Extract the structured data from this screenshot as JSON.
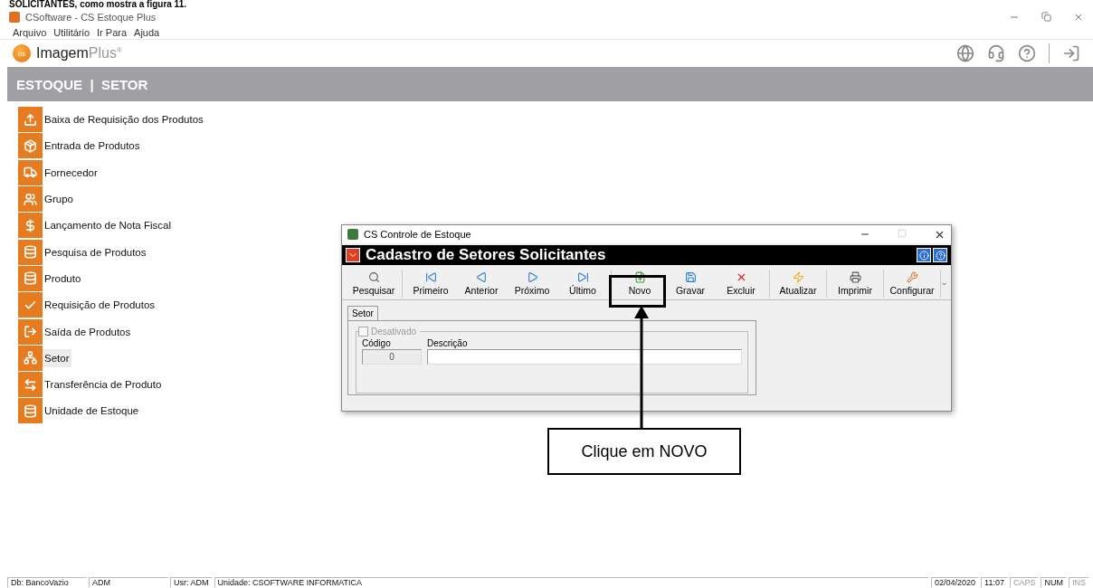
{
  "doc_caption": "SOLICITANTES, como mostra a figura 11.",
  "window": {
    "title": "CSoftware - CS Estoque Plus"
  },
  "menu": [
    "Arquivo",
    "Utilitário",
    "Ir Para",
    "Ajuda"
  ],
  "brand": {
    "logo_text": "cs",
    "name": "Imagem",
    "suffix": "Plus",
    "mark": "®"
  },
  "breadcrumb": "ESTOQUE  |  SETOR",
  "sidebar": {
    "items": [
      {
        "label": "Baixa de Requisição dos Produtos",
        "kind": "upload",
        "selected": false
      },
      {
        "label": "Entrada de Produtos",
        "kind": "box",
        "selected": false
      },
      {
        "label": "Fornecedor",
        "kind": "truck",
        "selected": false
      },
      {
        "label": "Grupo",
        "kind": "users",
        "selected": false
      },
      {
        "label": "Lançamento de Nota Fiscal",
        "kind": "money",
        "selected": false
      },
      {
        "label": "Pesquisa de Produtos",
        "kind": "cylinder",
        "selected": false
      },
      {
        "label": "Produto",
        "kind": "cylinder",
        "selected": false
      },
      {
        "label": "Requisição de Produtos",
        "kind": "check",
        "selected": false
      },
      {
        "label": "Saída de Produtos",
        "kind": "exit",
        "selected": false
      },
      {
        "label": "Setor",
        "kind": "tree",
        "selected": true
      },
      {
        "label": "Transferência de Produto",
        "kind": "transfer",
        "selected": false
      },
      {
        "label": "Unidade de Estoque",
        "kind": "cylinders",
        "selected": false
      }
    ]
  },
  "dialog": {
    "title": "CS Controle de Estoque",
    "header": "Cadastro de Setores Solicitantes",
    "toolbar": [
      [
        {
          "label": "Pesquisar",
          "kind": "search"
        }
      ],
      [
        {
          "label": "Primeiro",
          "kind": "first"
        },
        {
          "label": "Anterior",
          "kind": "prev"
        },
        {
          "label": "Próximo",
          "kind": "next"
        },
        {
          "label": "Último",
          "kind": "last"
        }
      ],
      [
        {
          "label": "Novo",
          "kind": "new"
        },
        {
          "label": "Gravar",
          "kind": "save"
        },
        {
          "label": "Excluir",
          "kind": "delete"
        }
      ],
      [
        {
          "label": "Atualizar",
          "kind": "refresh"
        }
      ],
      [
        {
          "label": "Imprimir",
          "kind": "print"
        }
      ],
      [
        {
          "label": "Configurar",
          "kind": "config"
        }
      ]
    ],
    "tab": {
      "label": "Setor",
      "selected": true
    },
    "checkbox": {
      "label": "Desativado",
      "checked": false,
      "disabled": true
    },
    "fields": [
      {
        "label": "Código",
        "value": "0",
        "disabled": true
      },
      {
        "label": "Descrição",
        "disabled": false
      }
    ]
  },
  "callout": {
    "text": "Clique em NOVO"
  },
  "status_bar": [
    {
      "text": "Db: BancoVazio",
      "on": true,
      "kind": "wide"
    },
    {
      "text": "ADM",
      "on": true,
      "kind": "wide"
    },
    {
      "text": "Usr: ADM",
      "on": true,
      "kind": "auto"
    },
    {
      "text": "Unidade: CSOFTWARE INFORMATICA",
      "on": true,
      "kind": "grow"
    },
    {
      "text": "02/04/2020",
      "on": true,
      "kind": "auto"
    },
    {
      "text": "11:07",
      "on": true,
      "kind": "auto"
    },
    {
      "text": "CAPS",
      "on": false,
      "kind": "auto"
    },
    {
      "text": "NUM",
      "on": true,
      "kind": "auto"
    },
    {
      "text": "INS",
      "on": false,
      "kind": "auto"
    }
  ]
}
